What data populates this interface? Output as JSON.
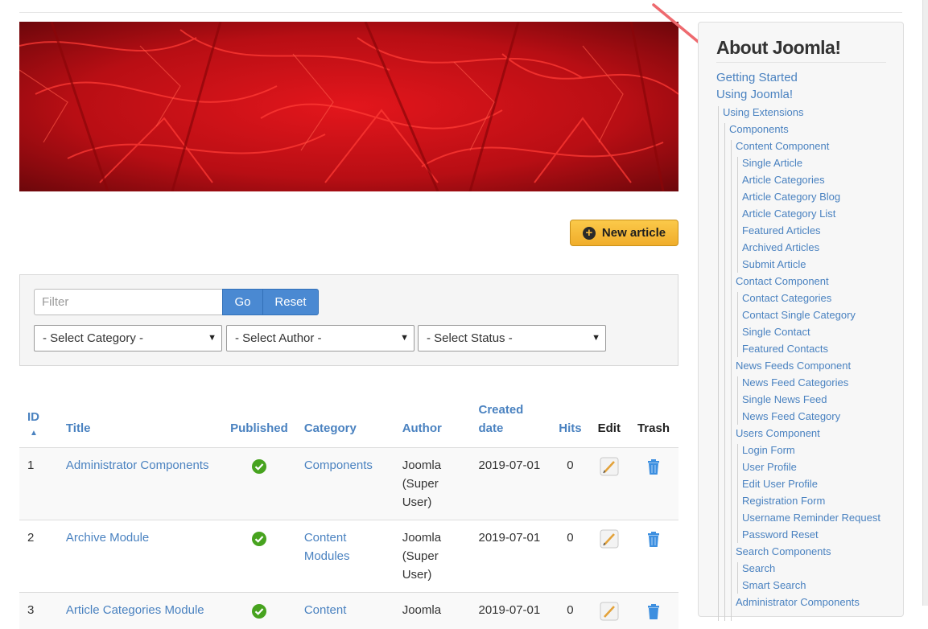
{
  "toolbar": {
    "new_article_label": "New article",
    "new_article_icon": "plus-circle-icon"
  },
  "filter": {
    "placeholder": "Filter",
    "value": "",
    "go_label": "Go",
    "reset_label": "Reset",
    "category_select": "- Select Category -",
    "author_select": "- Select Author -",
    "status_select": "- Select Status -"
  },
  "table": {
    "headers": {
      "id": "ID",
      "title": "Title",
      "published": "Published",
      "category": "Category",
      "author": "Author",
      "created_date": "Created date",
      "hits": "Hits",
      "edit": "Edit",
      "trash": "Trash"
    },
    "rows": [
      {
        "id": "1",
        "title": "Administrator Components",
        "category": "Components",
        "author": "Joomla (Super User)",
        "created": "2019-07-01",
        "hits": "0"
      },
      {
        "id": "2",
        "title": "Archive Module",
        "category": "Content Modules",
        "author": "Joomla (Super User)",
        "created": "2019-07-01",
        "hits": "0"
      },
      {
        "id": "3",
        "title": "Article Categories Module",
        "category": "Content",
        "author": "Joomla",
        "created": "2019-07-01",
        "hits": "0"
      }
    ]
  },
  "sidebar": {
    "title": "About Joomla!",
    "items": [
      {
        "label": "Getting Started"
      },
      {
        "label": "Using Joomla!"
      },
      {
        "label": "Using Extensions"
      },
      {
        "label": "Components"
      },
      {
        "label": "Content Component"
      },
      {
        "label": "Single Article"
      },
      {
        "label": "Article Categories"
      },
      {
        "label": "Article Category Blog"
      },
      {
        "label": "Article Category List"
      },
      {
        "label": "Featured Articles"
      },
      {
        "label": "Archived Articles"
      },
      {
        "label": "Submit Article"
      },
      {
        "label": "Contact Component"
      },
      {
        "label": "Contact Categories"
      },
      {
        "label": "Contact Single Category"
      },
      {
        "label": "Single Contact"
      },
      {
        "label": "Featured Contacts"
      },
      {
        "label": "News Feeds Component"
      },
      {
        "label": "News Feed Categories"
      },
      {
        "label": "Single News Feed"
      },
      {
        "label": "News Feed Category"
      },
      {
        "label": "Users Component"
      },
      {
        "label": "Login Form"
      },
      {
        "label": "User Profile"
      },
      {
        "label": "Edit User Profile"
      },
      {
        "label": "Registration Form"
      },
      {
        "label": "Username Reminder Request"
      },
      {
        "label": "Password Reset"
      },
      {
        "label": "Search Components"
      },
      {
        "label": "Search"
      },
      {
        "label": "Smart Search"
      },
      {
        "label": "Administrator Components"
      }
    ]
  },
  "colors": {
    "link": "#4a82c0",
    "primary_button": "#4a89d2",
    "accent_button": "#f5b73b",
    "published_icon": "#47a31f",
    "annotation_arrow": "#ee6a6f"
  }
}
